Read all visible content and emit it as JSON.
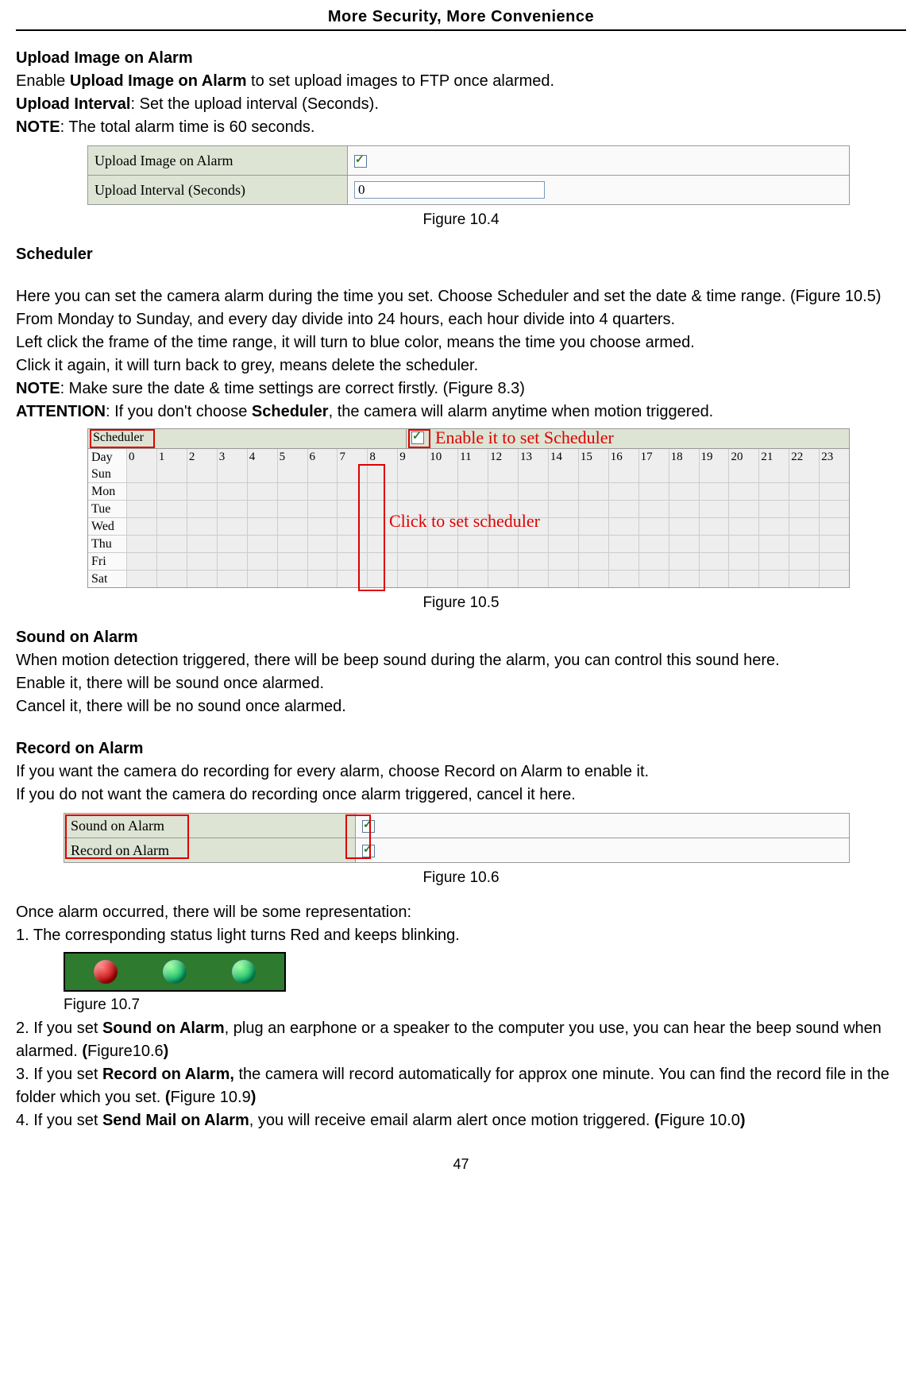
{
  "header": {
    "title": "More Security, More Convenience"
  },
  "upload": {
    "heading": "Upload Image on Alarm",
    "line1a": "Enable ",
    "line1b": "Upload Image on Alarm",
    "line1c": " to set upload images to FTP once alarmed.",
    "line2a": "Upload Interval",
    "line2b": ": Set the upload interval (Seconds).",
    "line3a": "NOTE",
    "line3b": ": The total alarm time is 60 seconds."
  },
  "fig104": {
    "row1_label": "Upload Image on Alarm",
    "row2_label": "Upload Interval (Seconds)",
    "row2_value": "0",
    "caption": "Figure 10.4"
  },
  "scheduler": {
    "heading": "Scheduler",
    "p1": "Here you can set the camera alarm during the time you set. Choose Scheduler and set the date & time range. (Figure 10.5) From Monday to Sunday, and every day divide into 24 hours, each hour divide into 4 quarters.",
    "p2": "Left click the frame of the time range, it will turn to blue color, means the time you choose armed.",
    "p3": "Click it again, it will turn back to grey, means delete the scheduler.",
    "note_a": "NOTE",
    "note_b": ": Make sure the date & time settings are correct firstly. (Figure 8.3)",
    "att_a": "ATTENTION",
    "att_b": ": If you don't choose ",
    "att_c": "Scheduler",
    "att_d": ", the camera will alarm anytime when motion triggered."
  },
  "fig105": {
    "label": "Scheduler",
    "enable_text": "Enable it to set Scheduler",
    "click_text": "Click to set scheduler",
    "day_header": "Day",
    "hours": [
      "0",
      "1",
      "2",
      "3",
      "4",
      "5",
      "6",
      "7",
      "8",
      "9",
      "10",
      "11",
      "12",
      "13",
      "14",
      "15",
      "16",
      "17",
      "18",
      "19",
      "20",
      "21",
      "22",
      "23"
    ],
    "days": [
      "Sun",
      "Mon",
      "Tue",
      "Wed",
      "Thu",
      "Fri",
      "Sat"
    ],
    "caption": "Figure 10.5"
  },
  "sound": {
    "heading": "Sound on Alarm",
    "p1": "When motion detection triggered, there will be beep sound during the alarm, you can control this sound here.",
    "p2": "Enable it, there will be sound once alarmed.",
    "p3": "Cancel it, there will be no sound once alarmed."
  },
  "record": {
    "heading": "Record on Alarm",
    "p1": "If you want the camera do recording for every alarm, choose Record on Alarm to enable it.",
    "p2": "If you do not want the camera do recording once alarm triggered, cancel it here."
  },
  "fig106": {
    "row1_label": "Sound on Alarm",
    "row2_label": "Record on Alarm",
    "caption": "Figure 10.6"
  },
  "rep": {
    "intro": "Once alarm occurred, there will be some representation:",
    "item1": "1. The corresponding status light turns Red and keeps blinking.",
    "fig107_caption": "Figure 10.7",
    "item2a": "2. If you set ",
    "item2b": "Sound on Alarm",
    "item2c": ", plug an earphone or a speaker to the computer you use, you can hear the beep sound when alarmed. ",
    "item2d": "(",
    "item2e": "Figure10.6",
    "item2f": ")",
    "item3a": "3. If you set ",
    "item3b": "Record on Alarm,",
    "item3c": " the camera will record automatically for approx one minute. You can find the record file in the folder which you set. ",
    "item3d": "(",
    "item3e": "Figure 10.9",
    "item3f": ")",
    "item4a": "4. If you set ",
    "item4b": "Send Mail on Alarm",
    "item4c": ", you will receive email alarm alert once motion triggered. ",
    "item4d": "(",
    "item4e": "Figure 10.0",
    "item4f": ")"
  },
  "page_number": "47"
}
